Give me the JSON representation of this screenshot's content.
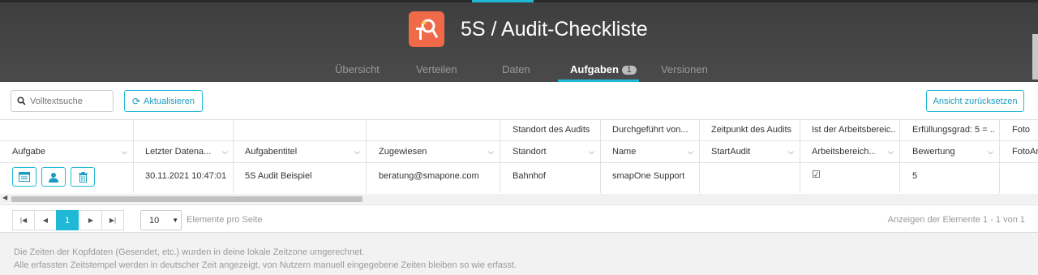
{
  "app": {
    "title": "5S / Audit-Checkliste",
    "logo_icon": "magnifier-tools-icon",
    "accent": "#1fb8d6",
    "logo_color": "#f06a4a"
  },
  "tabs": [
    {
      "label": "Übersicht"
    },
    {
      "label": "Verteilen"
    },
    {
      "label": "Daten"
    },
    {
      "label": "Aufgaben",
      "count": "1",
      "active": true
    },
    {
      "label": "Versionen"
    }
  ],
  "toolbar": {
    "search_placeholder": "Volltextsuche",
    "refresh_label": "Aktualisieren",
    "reset_label": "Ansicht zurücksetzen"
  },
  "grid": {
    "group_headers": [
      "",
      "",
      "",
      "",
      "Standort des Audits",
      "Durchgeführt von...",
      "Zeitpunkt des Audits",
      "Ist der Arbeitsbereic...",
      "Erfüllungsgrad: 5 = ...",
      "Foto"
    ],
    "columns": [
      "Aufgabe",
      "Letzter Datena...",
      "Aufgabentitel",
      "Zugewiesen",
      "Standort",
      "Name",
      "StartAudit",
      "Arbeitsbereich...",
      "Bewertung",
      "FotoAn"
    ],
    "row": {
      "date": "30.11.2021 10:47:01",
      "title": "5S Audit Beispiel",
      "assigned": "beratung@smapone.com",
      "location": "Bahnhof",
      "name": "smapOne Support",
      "start": "",
      "checked": true,
      "rating": "5"
    }
  },
  "pager": {
    "current": "1",
    "page_size": "10",
    "page_size_label": "Elemente pro Seite",
    "summary": "Anzeigen der Elemente 1 - 1 von 1"
  },
  "footer": {
    "line1": "Die Zeiten der Kopfdaten (Gesendet, etc.) wurden in deine lokale Zeitzone umgerechnet.",
    "line2": "Alle erfassten Zeitstempel werden in deutscher Zeit angezeigt, von Nutzern manuell eingegebene Zeiten bleiben so wie erfasst."
  }
}
